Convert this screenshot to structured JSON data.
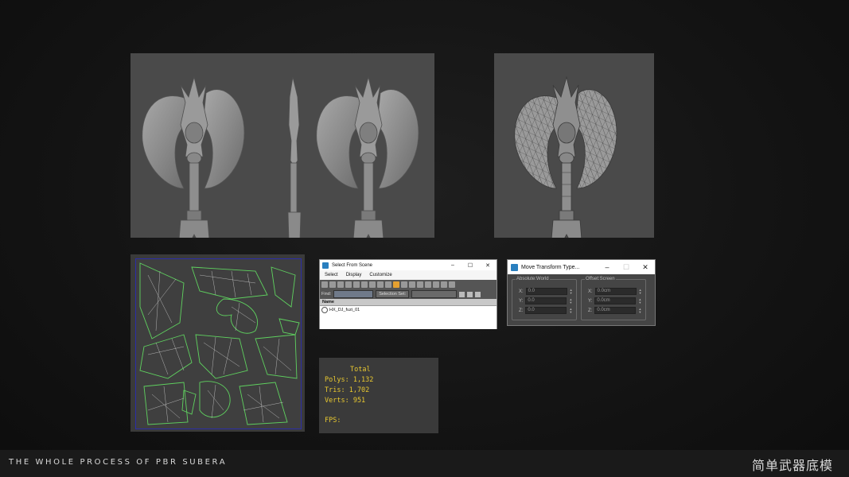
{
  "select_from_scene": {
    "title": "Select From Scene",
    "controls": [
      "–",
      "☐",
      "✕"
    ],
    "menu": [
      "Select",
      "Display",
      "Customize"
    ],
    "find_label": "Find:",
    "selection_set_label": "Selection Set:",
    "list_header": "Name",
    "items": [
      "HX_DJ_fuzi_01"
    ]
  },
  "move_transform": {
    "title": "Move Transform Type...",
    "controls": [
      "–",
      "☐",
      "✕"
    ],
    "absolute": {
      "title": "Absolute:World",
      "rows": [
        {
          "axis": "X:",
          "value": "0.0"
        },
        {
          "axis": "Y:",
          "value": "0.0"
        },
        {
          "axis": "Z:",
          "value": "0.0"
        }
      ]
    },
    "offset": {
      "title": "Offset:Screen",
      "rows": [
        {
          "axis": "X:",
          "value": "0.0cm"
        },
        {
          "axis": "Y:",
          "value": "0.0cm"
        },
        {
          "axis": "Z:",
          "value": "0.0cm"
        }
      ]
    }
  },
  "stats": {
    "heading": "Total",
    "polys": "Polys: 1,132",
    "tris": "Tris: 1,702",
    "verts": "Verts: 951",
    "fps": "FPS:"
  },
  "footer": {
    "left": "THE WHOLE PROCESS OF PBR SUBERA",
    "right": "简单武器底模"
  },
  "colors": {
    "uv_edge": "#5fd25f",
    "uv_inner": "#d8d8d8",
    "stats_text": "#e8c830"
  }
}
